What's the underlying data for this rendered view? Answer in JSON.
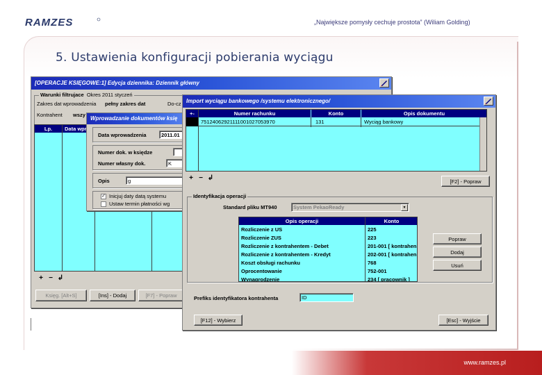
{
  "header": {
    "logo_text": "RAMZES",
    "quote": "„Największe pomysły cechuje prostota” (Wiliam Golding)",
    "slide_title": "5. Ustawienia konfiguracji pobierania wyciągu"
  },
  "footer": {
    "url": "www.ramzes.pl"
  },
  "colors": {
    "title_blue": "#2b3a6b",
    "footer_red": "#b81e1e",
    "grid_cyan": "#80ffff",
    "win_titlebar": "#1c2bb8"
  },
  "win_journal": {
    "title": "[OPERACJE KSIĘGOWE:1] Edycja dziennika: Dziennik główny",
    "filter_label": "Warunki filtrujace",
    "filter_value": "Okres 2011 styczeń",
    "range_label": "Zakres dat wprowadzenia",
    "range_value": "pełny zakres dat",
    "doc_label": "Do-cz",
    "contractor_label": "Kontrahent",
    "contractor_value": "wszy",
    "col_lp": "Lp.",
    "col_date": "Data wpr",
    "btn_ksieg": "Księg. [Alt+S]",
    "btn_add": "[Ins] - Dodaj",
    "btn_edit": "[F7] - Popraw"
  },
  "win_doc_entry": {
    "title": "Wprowadzanie dokumentów księ",
    "date_label": "Data wprowadzenia",
    "date_value": "2011.01",
    "docno_label": "Numer dok. w księdze",
    "ownno_label": "Numer własny dok.",
    "ownno_value": "K",
    "desc_label": "Opis",
    "desc_value": "g",
    "check1": "Inicjuj daty datą systemu",
    "check2": "Ustaw termin płatności wg"
  },
  "win_import": {
    "title": "Import wyciągu bankowego /systemu elektronicznego/",
    "table_headers": [
      "+-",
      "Numer rachunku",
      "Konto",
      "Opis dokumentu"
    ],
    "rows": [
      {
        "mark": "",
        "account_number": "75124062921111001027053970",
        "konto": "131",
        "opis": "Wyciąg bankowy"
      }
    ],
    "btn_f2": "[F2] - Popraw",
    "ident_label": "Identyfikacja operacji",
    "standard_label": "Standard pliku MT940",
    "standard_value": "System PekaoReady",
    "ops_headers": [
      "Opis operacji",
      "Konto"
    ],
    "ops": [
      {
        "opis": "Rozliczenie z US",
        "konto": "225"
      },
      {
        "opis": "Rozliczenie ZUS",
        "konto": "223"
      },
      {
        "opis": "Rozliczenie z kontrahentem - Debet",
        "konto": "201-001 [ kontrahen"
      },
      {
        "opis": "Rozliczenie z kontrahentem - Kredyt",
        "konto": "202-001 [ kontrahen"
      },
      {
        "opis": "Koszt obsługi rachunku",
        "konto": "768"
      },
      {
        "opis": "Oprocentowanie",
        "konto": "752-001"
      },
      {
        "opis": "Wynagrodzenie",
        "konto": "234 [ pracownik ]"
      }
    ],
    "btn_popraw": "Popraw",
    "btn_dodaj": "Dodaj",
    "btn_usun": "Usuń",
    "prefix_label": "Prefiks identyfikatora kontrahenta",
    "prefix_value": "ID",
    "btn_f12": "[F12] - Wybierz",
    "btn_esc": "[Esc] - Wyjście"
  }
}
